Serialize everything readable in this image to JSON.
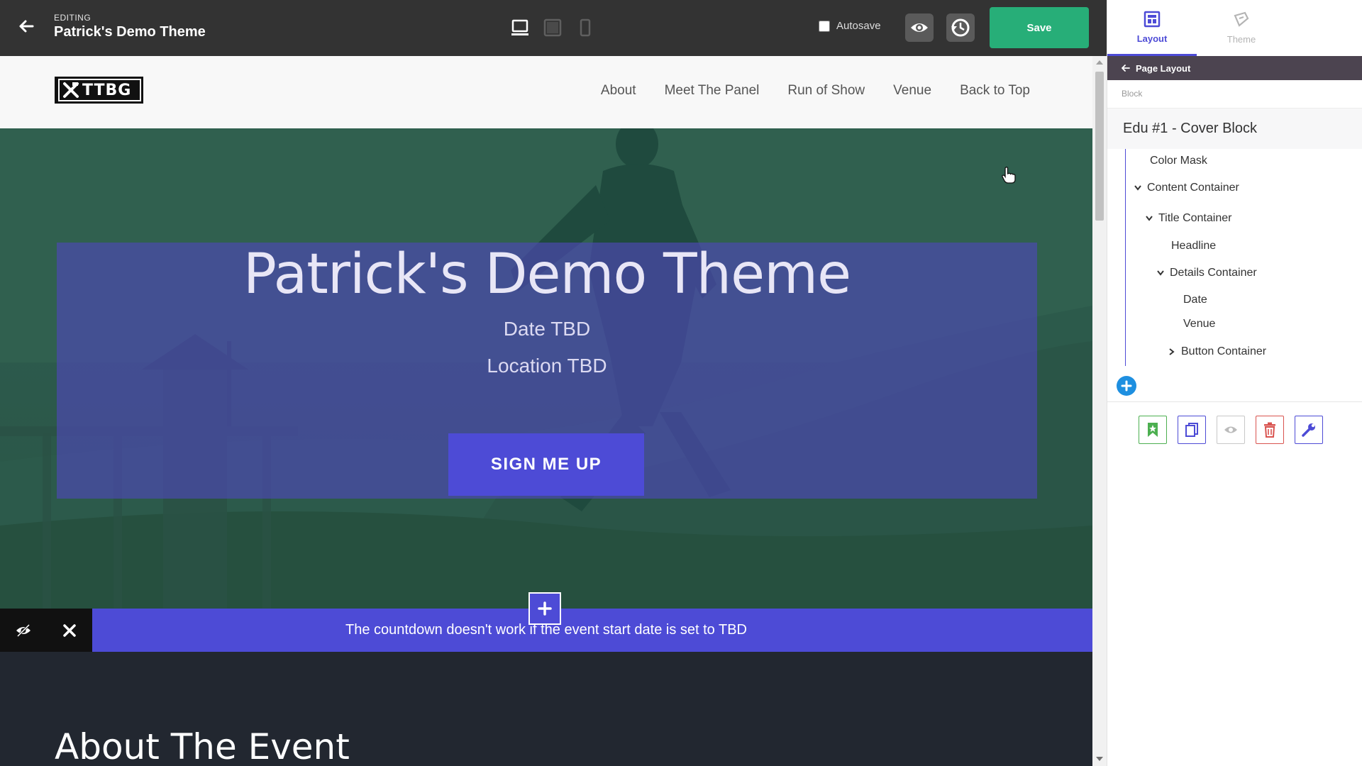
{
  "editor": {
    "editing_label": "EDITING",
    "page_title": "Patrick's Demo Theme",
    "autosave_label": "Autosave",
    "save_label": "Save"
  },
  "site": {
    "logo_text": "TTBG",
    "nav": [
      "About",
      "Meet The Panel",
      "Run of Show",
      "Venue",
      "Back to Top"
    ]
  },
  "hero": {
    "title": "Patrick's Demo Theme",
    "date": "Date TBD",
    "location": "Location TBD",
    "cta_label": "SIGN ME UP"
  },
  "countdown": {
    "message": "The countdown doesn't work if the event start date is set to TBD"
  },
  "about": {
    "title": "About The Event"
  },
  "panel": {
    "tabs": [
      {
        "label": "Layout",
        "active": true
      },
      {
        "label": "Theme",
        "active": false
      }
    ],
    "crumb": "Page Layout",
    "block_label": "Block",
    "block_title": "Edu #1 - Cover Block",
    "tree": [
      {
        "label": "Color Mask",
        "caret": "none"
      },
      {
        "label": "Content Container",
        "caret": "down"
      },
      {
        "label": "Title Container",
        "caret": "down"
      },
      {
        "label": "Headline",
        "caret": "none"
      },
      {
        "label": "Details Container",
        "caret": "down"
      },
      {
        "label": "Date",
        "caret": "none"
      },
      {
        "label": "Venue",
        "caret": "none"
      },
      {
        "label": "Button Container",
        "caret": "right"
      }
    ]
  },
  "colors": {
    "accent": "#4d4bd6",
    "save": "#27ae78",
    "topbar": "#333333",
    "crumb": "#4c4450"
  }
}
